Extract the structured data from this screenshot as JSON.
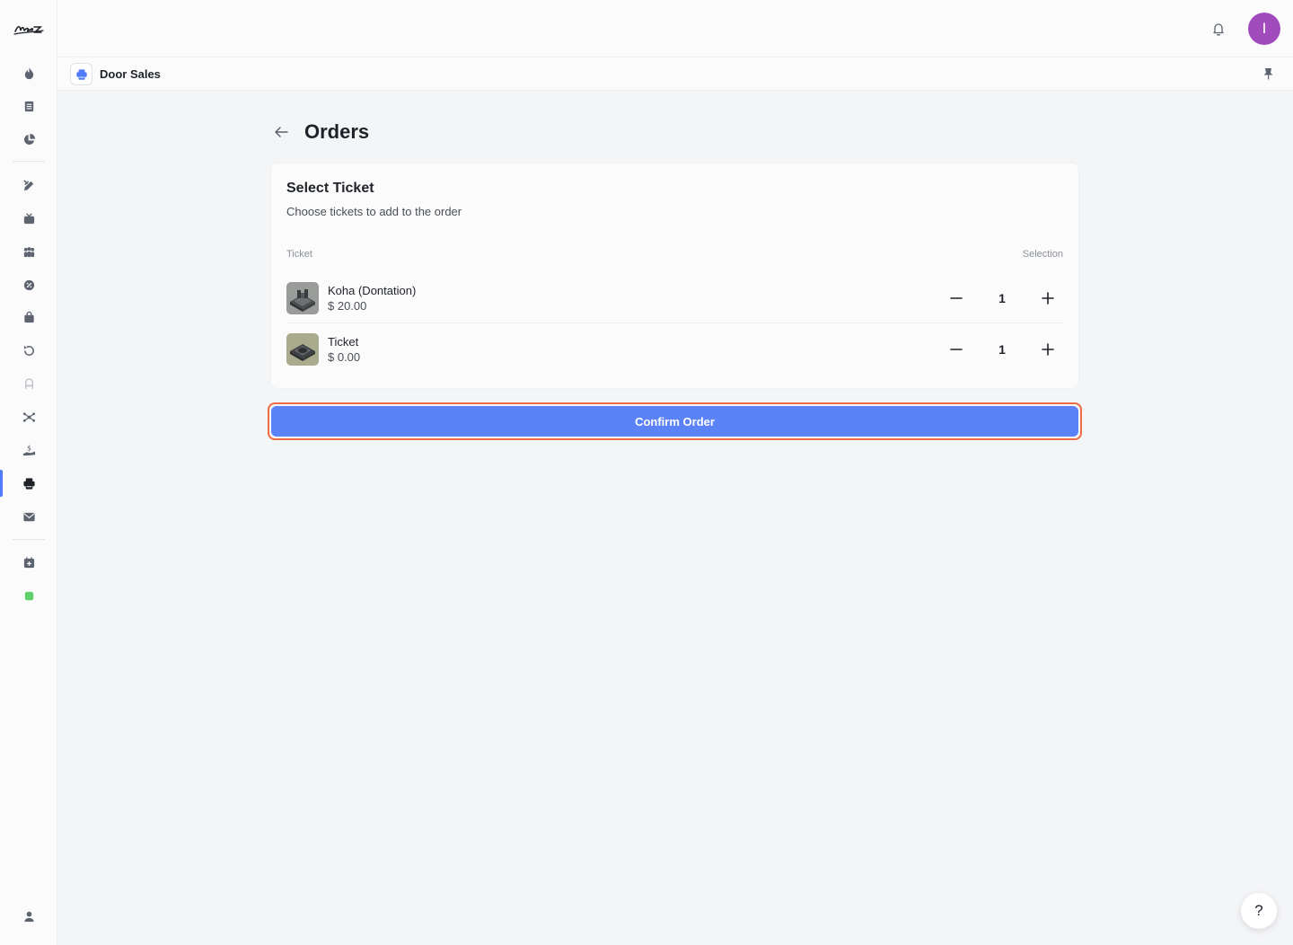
{
  "header": {
    "avatar_initial": "I"
  },
  "tab": {
    "label": "Door Sales"
  },
  "page": {
    "title": "Orders"
  },
  "card": {
    "title": "Select Ticket",
    "subtitle": "Choose tickets to add to the order",
    "columns": {
      "ticket": "Ticket",
      "selection": "Selection"
    },
    "tickets": [
      {
        "name": "Koha (Dontation)",
        "price": "$ 20.00",
        "quantity": "1"
      },
      {
        "name": "Ticket",
        "price": "$ 0.00",
        "quantity": "1"
      }
    ]
  },
  "actions": {
    "confirm_label": "Confirm Order",
    "help_label": "?"
  },
  "colors": {
    "accent": "#5b82f7",
    "highlight_border": "#ef6c45",
    "avatar": "#a24bbd",
    "status_dot": "#5fcf6b"
  },
  "icons": {
    "sidebar": [
      "flame-icon",
      "document-icon",
      "pie-chart-icon",
      "edit-tools-icon",
      "tv-icon",
      "people-icon",
      "badge-icon",
      "bag-icon",
      "refresh-icon",
      "seat-icon",
      "network-icon",
      "donation-icon",
      "printer-icon",
      "mail-icon",
      "calendar-add-icon",
      "status-dot-icon",
      "user-icon"
    ]
  }
}
